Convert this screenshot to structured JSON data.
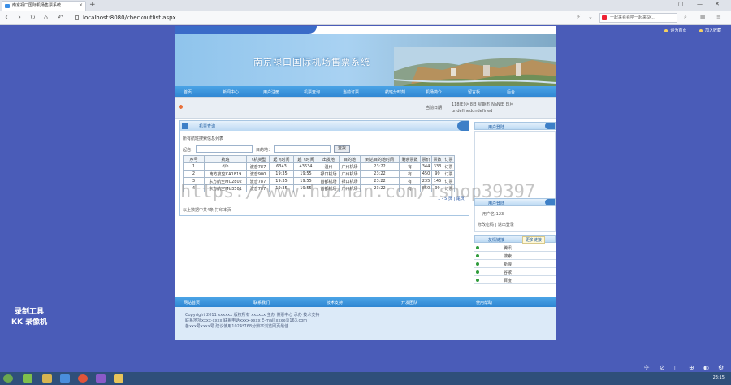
{
  "browser": {
    "tab_title": "南京禄口国际机场售票系统",
    "url": "localhost:8080/checkoutlist.aspx",
    "search_text": "一起来看看吧一起来SK…"
  },
  "site": {
    "title": "南京禄口国际机场售票系统",
    "top_links": [
      "设为首页",
      "加入收藏"
    ],
    "nav": [
      "首页",
      "新闻中心",
      "用户注册",
      "机票查询",
      "当前订票",
      "航班分时刻",
      "机场简介",
      "留言板",
      "后台"
    ],
    "date_label": "当前日期",
    "date_value": "118年9月8日 星期五 NaN年 日月 undefinedundefined"
  },
  "panel": {
    "title": "机票查询",
    "subtitle": "所有航班搜索信息列表",
    "from_label": "起自：",
    "to_label": "目的地：",
    "search_button": "查找"
  },
  "table": {
    "headers": [
      "序号",
      "航班",
      "飞机类型",
      "起飞时间",
      "起飞时间",
      "出发地",
      "目的地",
      "到达目的地时间",
      "剩余票数",
      "票价",
      "票数",
      "订票"
    ],
    "rows": [
      [
        "1",
        "d/h",
        "波音787",
        "6343",
        "43634",
        "温州",
        "广州机场",
        "23:22",
        "有",
        "344",
        "333",
        "订票"
      ],
      [
        "2",
        "南方航空CA1819",
        "波音900",
        "19:35",
        "19:55",
        "禄口机场",
        "广州机场",
        "23:22",
        "有",
        "450",
        "99",
        "订票"
      ],
      [
        "3",
        "东方航空MU2802",
        "波音787",
        "19:35",
        "19:55",
        "首都机场",
        "禄口机场",
        "23:22",
        "有",
        "235",
        "145",
        "订票"
      ],
      [
        "4",
        "东方航空MU3501",
        "波音787",
        "19:35",
        "19:55",
        "首都机场",
        "广州机场",
        "23:22",
        "有",
        "850",
        "99",
        "订票"
      ]
    ],
    "pager": "1 - 5 页 | 尾页",
    "footer": "以上数据中共4条 打印本页"
  },
  "sidebar": {
    "login_title": "用户登陆",
    "user_panel_title": "用户登陆",
    "user_name": "用户名:123",
    "user_logout": "修改密码 | 退出登录",
    "links_title": "友情链接",
    "links_extra": "更多链接",
    "links": [
      "腾讯",
      "搜索",
      "新浪",
      "谷歌",
      "百度"
    ]
  },
  "bottom_nav": [
    "网站首页",
    "联系我们",
    "技术支持",
    "开发团队",
    "使用帮助"
  ],
  "copyright": [
    "Copyright 2011 xxxxxx 版权所有 xxxxxx 主办 供票中心 承办 技术支持",
    "联系地址xxxx-xxxx 联系电话xxxx-xxxx E-mail:xxxx@163.com",
    "备xxx号xxxx号    建议使用1024*768分辨率浏览网页最佳"
  ],
  "watermark": "https://www.huzhan.com/ishop39397",
  "kk": [
    "录制工具",
    "KK 录像机"
  ],
  "clock": "23:15"
}
